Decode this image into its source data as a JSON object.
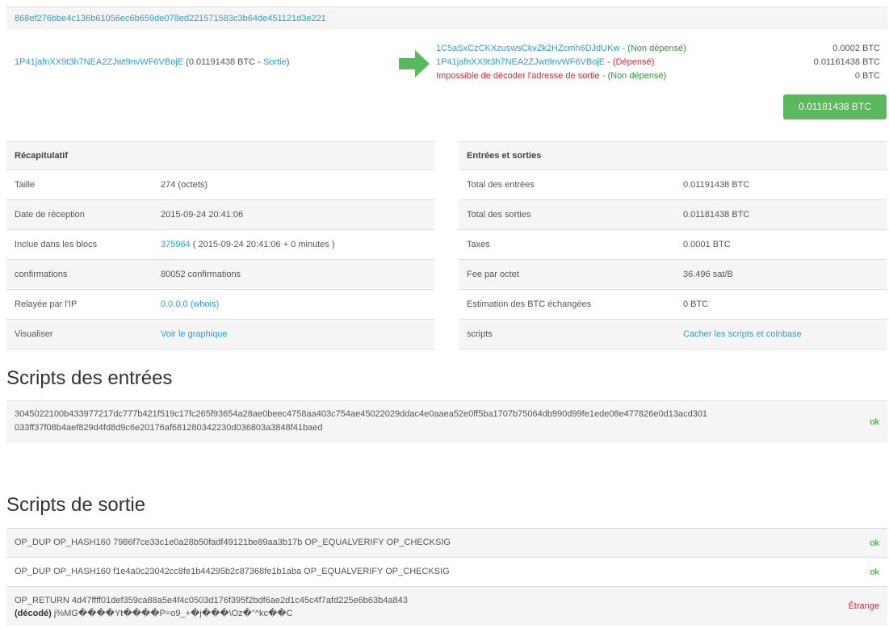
{
  "tx_hash": "868ef276bbe4c136b61056ec6b659de078ed221571583c3b64de451121d3e221",
  "input": {
    "address": "1P41jafnXX9t3h7NEA2ZJwt9nvWF6VBojE",
    "detail_prefix": " (0.01191438 BTC - ",
    "detail_link": "Sortie",
    "detail_suffix": ")"
  },
  "outputs": [
    {
      "address": "1C5aSxCzCKXzuswsCkvZk2HZcmh6DJdUKw",
      "sep": " - (",
      "status": "Non dépensé",
      "end": ")",
      "amount": "0.0002 BTC",
      "status_color": "green"
    },
    {
      "address": "1P41jafnXX9t3h7NEA2ZJwt9nvWF6VBojE",
      "sep": " - (",
      "status": "Dépensé",
      "end": ")",
      "amount": "0.01161438 BTC",
      "status_color": "red"
    },
    {
      "address": "Impossible de décoder l'adresse de sortie",
      "sep": " - (",
      "status": "Non dépensé",
      "end": ")",
      "amount": "0 BTC",
      "status_color": "green"
    }
  ],
  "total_output": "0.01181438 BTC",
  "summary": {
    "title": "Récapitulatif",
    "rows": [
      {
        "label": "Taille",
        "value": "274 (octets)"
      },
      {
        "label": "Date de réception",
        "value": "2015-09-24 20:41:06"
      },
      {
        "label": "Inclue dans les blocs",
        "link": "375964",
        "value": " ( 2015-09-24 20:41:06 + 0 minutes )"
      },
      {
        "label": "confirmations",
        "value": "80052 confirmations"
      },
      {
        "label": "Relayée par l'IP",
        "link": "0.0.0.0 (whois)"
      },
      {
        "label": "Visualiser",
        "link": "Voir le graphique"
      }
    ]
  },
  "io": {
    "title": "Entrées et sorties",
    "rows": [
      {
        "label": "Total des entrées",
        "value": "0.01191438 BTC"
      },
      {
        "label": "Total des sorties",
        "value": "0.01181438 BTC"
      },
      {
        "label": "Taxes",
        "value": "0.0001 BTC"
      },
      {
        "label": "Fee par octet",
        "value": "36.496 sat/B"
      },
      {
        "label": "Estimation des BTC échangées",
        "value": "0 BTC"
      },
      {
        "label": "scripts",
        "link": "Cacher les scripts et coinbase"
      }
    ]
  },
  "input_scripts": {
    "title": "Scripts des entrées",
    "rows": [
      {
        "line1": "3045022100b433977217dc777b421f519c17fc265f93654a28ae0beec4758aa403c754ae45022029ddac4e0aaea52e0ff5ba1707b75064db990d99fe1ede08e477826e0d13acd301",
        "line2": "033ff37f08b4aef829d4fd8d9c6e20176af681280342230d036803a3848f41baed",
        "status": "ok"
      }
    ]
  },
  "output_scripts": {
    "title": "Scripts de sortie",
    "rows": [
      {
        "line1": "OP_DUP OP_HASH160 7986f7ce33c1e0a28b50fadf49121be89aa3b17b OP_EQUALVERIFY OP_CHECKSIG",
        "status": "ok"
      },
      {
        "line1": "OP_DUP OP_HASH160 f1e4a0c23042cc8fe1b44295b2c87368fe1b1aba OP_EQUALVERIFY OP_CHECKSIG",
        "status": "ok"
      },
      {
        "line1": "OP_RETURN 4d47ffff01def359ca88a5e4f4c0503d176f395f2bdf6ae2d1c45c4f7afd225e6b63b4a843",
        "decoded_label": "(décodé)",
        "decoded": " j%MG����Yŧ����P=o9_+�j���\\Oz�\"^kc��C",
        "status": "Étrange"
      }
    ]
  },
  "colors": {
    "link": "#2a9fd6",
    "ok": "#2e9b2e",
    "bad": "#ee2233",
    "button": "#5cb85c"
  }
}
